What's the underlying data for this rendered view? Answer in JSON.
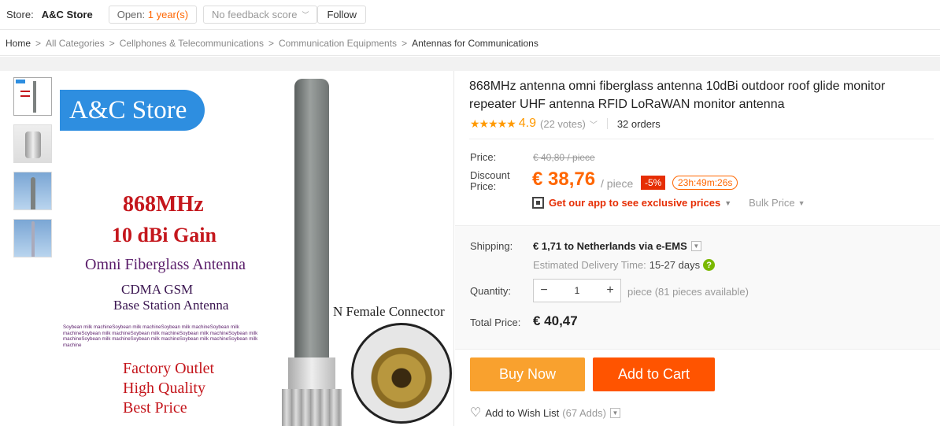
{
  "topbar": {
    "store_label": "Store:",
    "store_name": "A&C Store",
    "open_label": "Open:",
    "open_value": "1 year(s)",
    "feedback": "No feedback score",
    "follow": "Follow"
  },
  "breadcrumb": {
    "items": [
      "Home",
      "All Categories",
      "Cellphones & Telecommunications",
      "Communication Equipments",
      "Antennas for Communications"
    ],
    "separator": ">"
  },
  "gallery": {
    "banner": "A&C Store",
    "freq": "868MHz",
    "gain": "10 dBi Gain",
    "omni": "Omni Fiberglass Antenna",
    "cdma": "CDMA GSM",
    "base": "Base Station Antenna",
    "small_text": "Soybean milk machineSoybean milk machineSoybean milk machineSoybean milk machineSoybean milk machineSoybean milk machineSoybean milk machineSoybean milk machineSoybean milk machineSoybean milk machineSoybean milk machineSoybean milk machine",
    "connector": "N Female Connector",
    "factory": "Factory Outlet",
    "quality": "High Quality",
    "best": "Best Price"
  },
  "product": {
    "title": "868MHz antenna omni fiberglass antenna 10dBi outdoor roof glide monitor repeater UHF antenna RFID LoRaWAN monitor antenna",
    "stars": "★★★★★",
    "rating": "4.9",
    "votes": "(22 votes)",
    "orders": "32 orders",
    "price_label": "Price:",
    "old_price": "€ 40,80 / piece",
    "discount_label": "Discount Price:",
    "new_price": "€ 38,76",
    "per_piece": "/ piece",
    "percent": "-5%",
    "timer": "23h:49m:26s",
    "app_text": "Get our app to see exclusive prices",
    "bulk": "Bulk Price",
    "shipping_label": "Shipping:",
    "shipping_value": "€ 1,71 to Netherlands via e-EMS",
    "est_label": "Estimated Delivery Time:",
    "est_days": "15-27 days",
    "qty_label": "Quantity:",
    "qty_value": "1",
    "availability": "piece (81 pieces available)",
    "total_label": "Total Price:",
    "total_value": "€ 40,47",
    "buy_now": "Buy Now",
    "add_to_cart": "Add to Cart",
    "wishlist": "Add to Wish List",
    "wish_count": "(67 Adds)"
  },
  "colors": {
    "accent": "#ff6600",
    "cart": "#ff5400",
    "buy": "#f9a12e",
    "discount_badge": "#e62e04"
  }
}
